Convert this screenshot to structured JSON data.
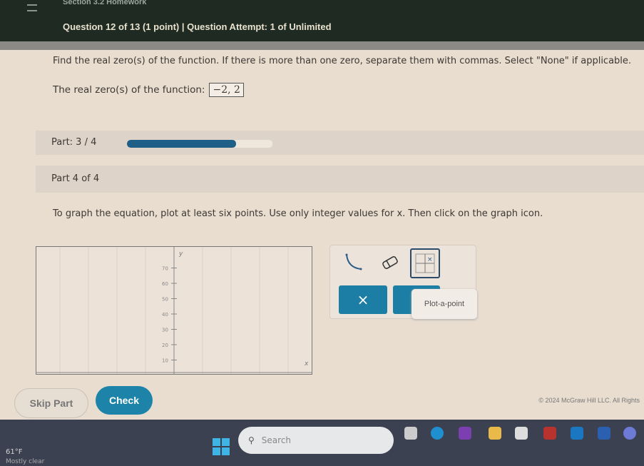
{
  "header": {
    "course": "Section 3.2 Homework",
    "question_info": "Question 12 of 13 (1 point)  |  Question Attempt: 1 of Unlimited"
  },
  "question": {
    "prompt": "Find the real zero(s) of the function. If there is more than one zero, separate them with commas. Select \"None\" if applicable.",
    "answer_label": "The real zero(s) of the function:",
    "answer_value": "−2, 2"
  },
  "progress": {
    "label": "Part: 3 / 4",
    "fraction": 0.75
  },
  "part": {
    "label": "Part 4 of 4",
    "instruction": "To graph the equation, plot at least six points. Use only integer values for x. Then click on the graph icon."
  },
  "graph": {
    "y_label": "y",
    "x_label": "x",
    "y_ticks": [
      "10",
      "20",
      "30",
      "40",
      "50",
      "60",
      "70"
    ]
  },
  "tools": {
    "icons": [
      "curve-icon",
      "eraser-icon",
      "plot-point-icon"
    ],
    "clear_label": "×",
    "tooltip": "Plot-a-point"
  },
  "actions": {
    "skip": "Skip Part",
    "check": "Check"
  },
  "footer": {
    "copyright": "© 2024 McGraw Hill LLC. All Rights"
  },
  "taskbar": {
    "temperature": "61°F",
    "weather": "Mostly clear",
    "search_placeholder": "Search"
  },
  "colors": {
    "header": "#1f2a22",
    "accent": "#1d83a8",
    "progress": "#1d5f86"
  }
}
